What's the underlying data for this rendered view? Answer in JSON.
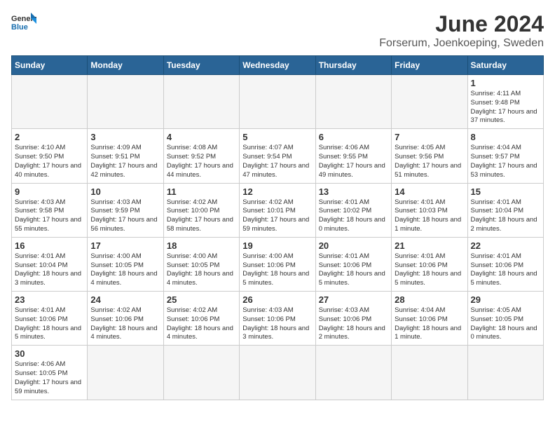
{
  "header": {
    "logo_general": "General",
    "logo_blue": "Blue",
    "month_title": "June 2024",
    "location": "Forserum, Joenkoeping, Sweden"
  },
  "days_of_week": [
    "Sunday",
    "Monday",
    "Tuesday",
    "Wednesday",
    "Thursday",
    "Friday",
    "Saturday"
  ],
  "weeks": [
    [
      {
        "day": "",
        "info": ""
      },
      {
        "day": "",
        "info": ""
      },
      {
        "day": "",
        "info": ""
      },
      {
        "day": "",
        "info": ""
      },
      {
        "day": "",
        "info": ""
      },
      {
        "day": "",
        "info": ""
      },
      {
        "day": "1",
        "info": "Sunrise: 4:11 AM\nSunset: 9:48 PM\nDaylight: 17 hours\nand 37 minutes."
      }
    ],
    [
      {
        "day": "2",
        "info": "Sunrise: 4:10 AM\nSunset: 9:50 PM\nDaylight: 17 hours\nand 40 minutes."
      },
      {
        "day": "3",
        "info": "Sunrise: 4:09 AM\nSunset: 9:51 PM\nDaylight: 17 hours\nand 42 minutes."
      },
      {
        "day": "4",
        "info": "Sunrise: 4:08 AM\nSunset: 9:52 PM\nDaylight: 17 hours\nand 44 minutes."
      },
      {
        "day": "5",
        "info": "Sunrise: 4:07 AM\nSunset: 9:54 PM\nDaylight: 17 hours\nand 47 minutes."
      },
      {
        "day": "6",
        "info": "Sunrise: 4:06 AM\nSunset: 9:55 PM\nDaylight: 17 hours\nand 49 minutes."
      },
      {
        "day": "7",
        "info": "Sunrise: 4:05 AM\nSunset: 9:56 PM\nDaylight: 17 hours\nand 51 minutes."
      },
      {
        "day": "8",
        "info": "Sunrise: 4:04 AM\nSunset: 9:57 PM\nDaylight: 17 hours\nand 53 minutes."
      }
    ],
    [
      {
        "day": "9",
        "info": "Sunrise: 4:03 AM\nSunset: 9:58 PM\nDaylight: 17 hours\nand 55 minutes."
      },
      {
        "day": "10",
        "info": "Sunrise: 4:03 AM\nSunset: 9:59 PM\nDaylight: 17 hours\nand 56 minutes."
      },
      {
        "day": "11",
        "info": "Sunrise: 4:02 AM\nSunset: 10:00 PM\nDaylight: 17 hours\nand 58 minutes."
      },
      {
        "day": "12",
        "info": "Sunrise: 4:02 AM\nSunset: 10:01 PM\nDaylight: 17 hours\nand 59 minutes."
      },
      {
        "day": "13",
        "info": "Sunrise: 4:01 AM\nSunset: 10:02 PM\nDaylight: 18 hours\nand 0 minutes."
      },
      {
        "day": "14",
        "info": "Sunrise: 4:01 AM\nSunset: 10:03 PM\nDaylight: 18 hours\nand 1 minute."
      },
      {
        "day": "15",
        "info": "Sunrise: 4:01 AM\nSunset: 10:04 PM\nDaylight: 18 hours\nand 2 minutes."
      }
    ],
    [
      {
        "day": "16",
        "info": "Sunrise: 4:01 AM\nSunset: 10:04 PM\nDaylight: 18 hours\nand 3 minutes."
      },
      {
        "day": "17",
        "info": "Sunrise: 4:00 AM\nSunset: 10:05 PM\nDaylight: 18 hours\nand 4 minutes."
      },
      {
        "day": "18",
        "info": "Sunrise: 4:00 AM\nSunset: 10:05 PM\nDaylight: 18 hours\nand 4 minutes."
      },
      {
        "day": "19",
        "info": "Sunrise: 4:00 AM\nSunset: 10:06 PM\nDaylight: 18 hours\nand 5 minutes."
      },
      {
        "day": "20",
        "info": "Sunrise: 4:01 AM\nSunset: 10:06 PM\nDaylight: 18 hours\nand 5 minutes."
      },
      {
        "day": "21",
        "info": "Sunrise: 4:01 AM\nSunset: 10:06 PM\nDaylight: 18 hours\nand 5 minutes."
      },
      {
        "day": "22",
        "info": "Sunrise: 4:01 AM\nSunset: 10:06 PM\nDaylight: 18 hours\nand 5 minutes."
      }
    ],
    [
      {
        "day": "23",
        "info": "Sunrise: 4:01 AM\nSunset: 10:06 PM\nDaylight: 18 hours\nand 5 minutes."
      },
      {
        "day": "24",
        "info": "Sunrise: 4:02 AM\nSunset: 10:06 PM\nDaylight: 18 hours\nand 4 minutes."
      },
      {
        "day": "25",
        "info": "Sunrise: 4:02 AM\nSunset: 10:06 PM\nDaylight: 18 hours\nand 4 minutes."
      },
      {
        "day": "26",
        "info": "Sunrise: 4:03 AM\nSunset: 10:06 PM\nDaylight: 18 hours\nand 3 minutes."
      },
      {
        "day": "27",
        "info": "Sunrise: 4:03 AM\nSunset: 10:06 PM\nDaylight: 18 hours\nand 2 minutes."
      },
      {
        "day": "28",
        "info": "Sunrise: 4:04 AM\nSunset: 10:06 PM\nDaylight: 18 hours\nand 1 minute."
      },
      {
        "day": "29",
        "info": "Sunrise: 4:05 AM\nSunset: 10:05 PM\nDaylight: 18 hours\nand 0 minutes."
      }
    ],
    [
      {
        "day": "30",
        "info": "Sunrise: 4:06 AM\nSunset: 10:05 PM\nDaylight: 17 hours\nand 59 minutes."
      },
      {
        "day": "",
        "info": ""
      },
      {
        "day": "",
        "info": ""
      },
      {
        "day": "",
        "info": ""
      },
      {
        "day": "",
        "info": ""
      },
      {
        "day": "",
        "info": ""
      },
      {
        "day": "",
        "info": ""
      }
    ]
  ]
}
